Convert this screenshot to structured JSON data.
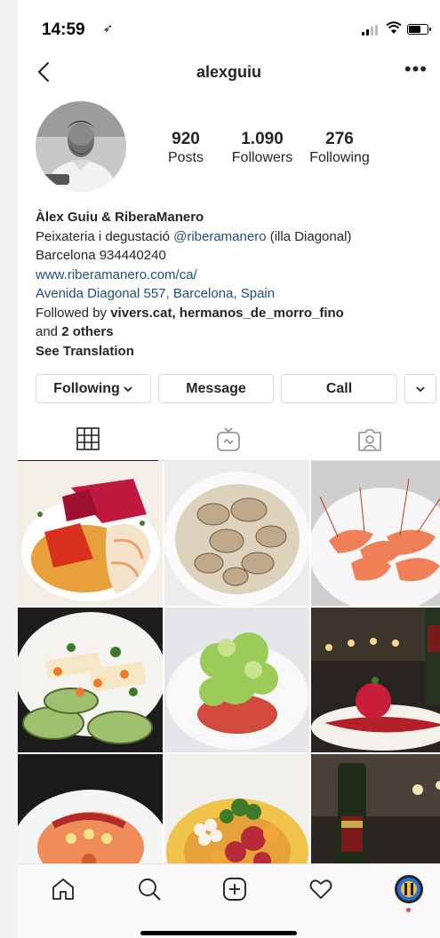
{
  "status_bar": {
    "time": "14:59",
    "location_glyph": "➶"
  },
  "header": {
    "username": "alexguiu",
    "more_glyph": "•••"
  },
  "stats": [
    {
      "number": "920",
      "label": "Posts"
    },
    {
      "number": "1.090",
      "label": "Followers"
    },
    {
      "number": "276",
      "label": "Following"
    }
  ],
  "bio": {
    "name": "Àlex Guiu & RiberaManero",
    "line1_prefix": "Peixateria i degustació ",
    "line1_mention": "@riberamanero",
    "line1_suffix": "  (illa Diagonal)",
    "line2": "Barcelona 934440240",
    "website": "www.riberamanero.com/ca/",
    "address": "Avenida Diagonal 557, Barcelona, Spain",
    "followed_prefix": "Followed by ",
    "followed_users": "vivers.cat, hermanos_de_morro_fino",
    "followed_and": "and ",
    "followed_others": "2 others",
    "see_translation": "See Translation"
  },
  "buttons": {
    "following": "Following",
    "message": "Message",
    "call": "Call"
  },
  "tabs": [
    {
      "name": "grid-icon"
    },
    {
      "name": "igtv-icon"
    },
    {
      "name": "tagged-icon"
    }
  ],
  "posts": [
    "prawn-tomato-dish",
    "truffle-risotto",
    "red-prawns",
    "zucchini-carpaccio",
    "frisee-salad-tartare",
    "sorbet-plate-restaurant",
    "gazpacho-bowl",
    "tuna-tartare-vegetables",
    "wine-bottle-restaurant"
  ],
  "bottom_nav": [
    "home-icon",
    "search-icon",
    "add-icon",
    "heart-icon",
    "profile-avatar"
  ],
  "colors": {
    "link": "#1f4f82",
    "text": "#262626",
    "border": "#dbdbdb",
    "notification": "#ed4956"
  }
}
